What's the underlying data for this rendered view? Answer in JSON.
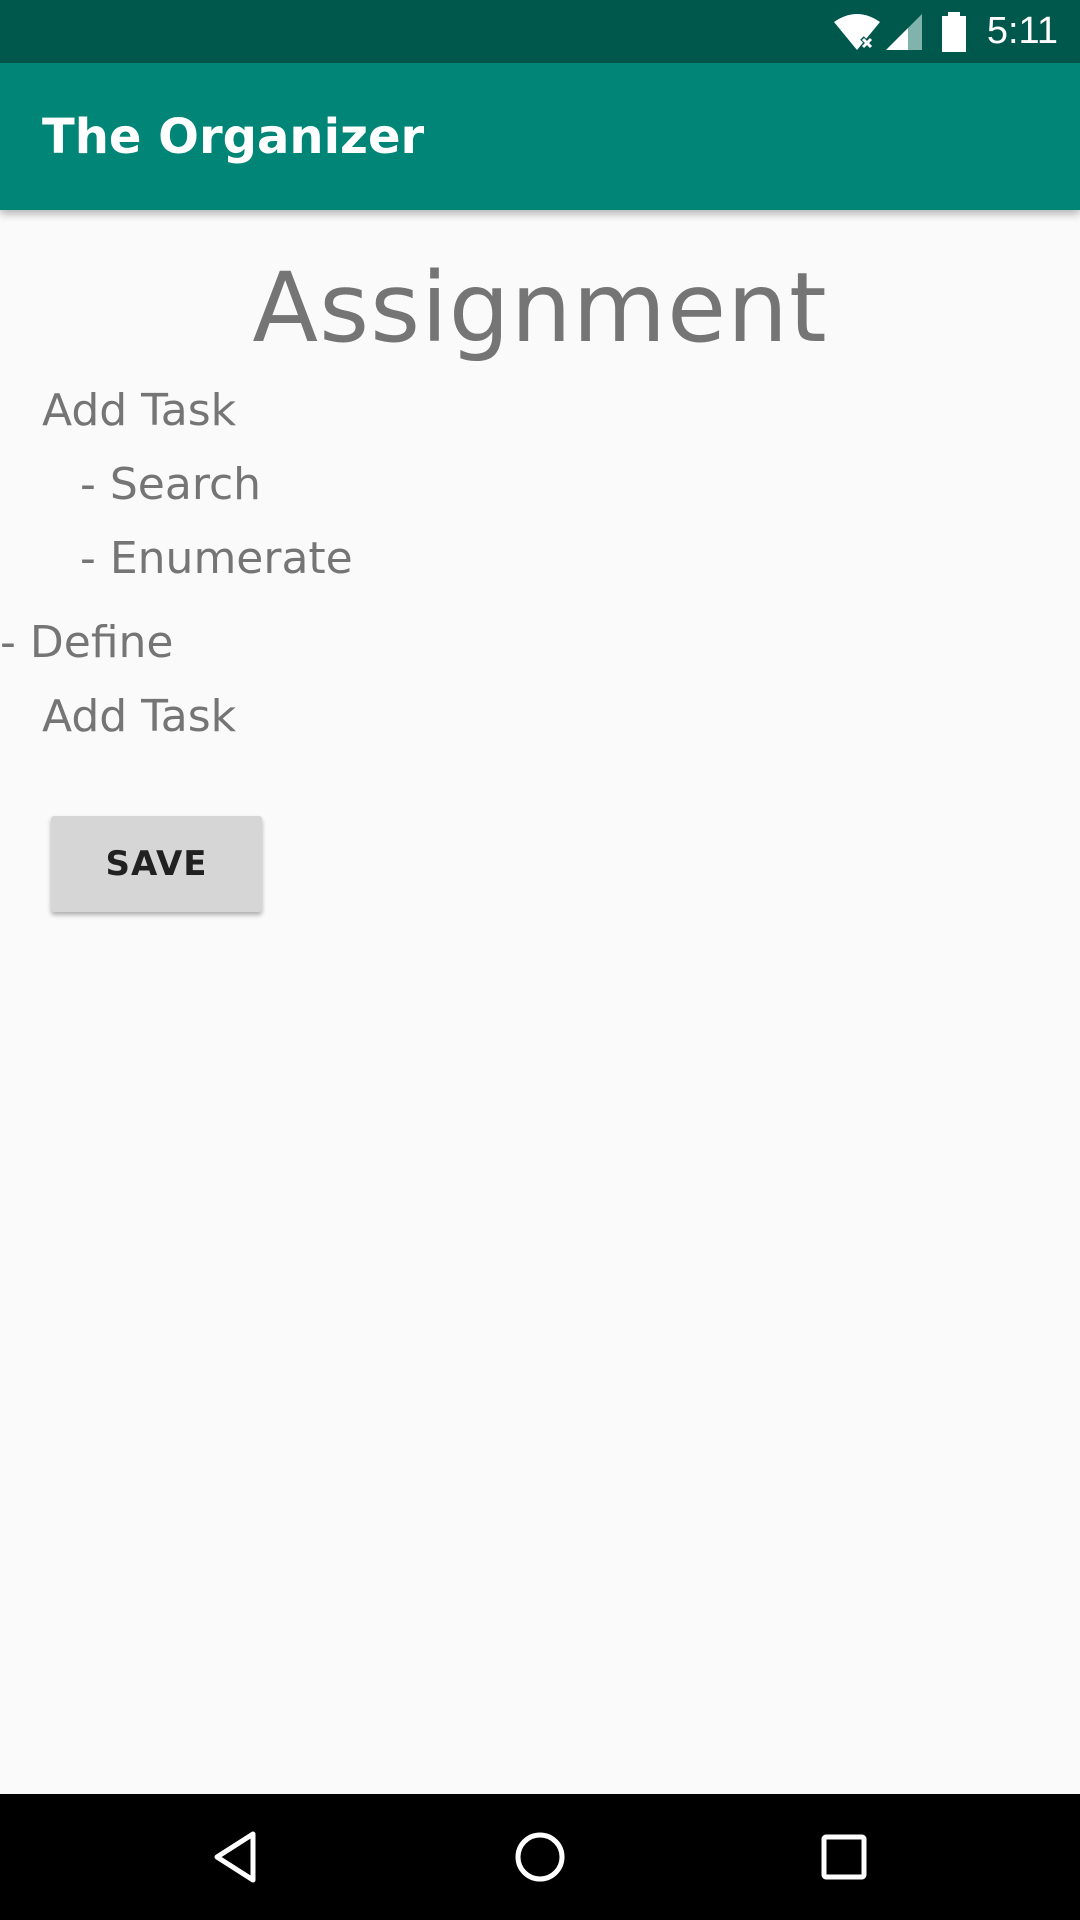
{
  "status_bar": {
    "time": "5:11"
  },
  "app_bar": {
    "title": "The Organizer"
  },
  "main": {
    "heading": "Assignment",
    "items": [
      {
        "text": "Add Task"
      },
      {
        "text": "- Search"
      },
      {
        "text": "- Enumerate"
      },
      {
        "text": "- Define"
      },
      {
        "text": "Add Task"
      }
    ],
    "save_label": "SAVE"
  },
  "colors": {
    "status_bar": "#00574b",
    "app_bar": "#008577",
    "background": "#fafafa",
    "text_secondary": "#757575",
    "button": "#d6d6d6"
  }
}
